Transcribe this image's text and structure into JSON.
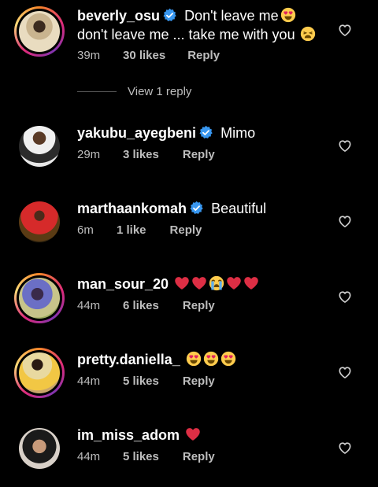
{
  "comments": [
    {
      "username": "beverly_osu",
      "verified": true,
      "text": "Don't leave me",
      "text_line2": "don't leave me ... take me with you",
      "time": "39m",
      "likes": "30 likes",
      "reply": "Reply",
      "story_ring": true
    },
    {
      "username": "yakubu_ayegbeni",
      "verified": true,
      "text": "Mimo",
      "time": "29m",
      "likes": "3 likes",
      "reply": "Reply",
      "story_ring": false
    },
    {
      "username": "marthaankomah",
      "verified": true,
      "text": "Beautiful",
      "time": "6m",
      "likes": "1 like",
      "reply": "Reply",
      "story_ring": false
    },
    {
      "username": "man_sour_20",
      "verified": false,
      "text": "",
      "time": "44m",
      "likes": "6 likes",
      "reply": "Reply",
      "story_ring": true
    },
    {
      "username": "pretty.daniella_",
      "verified": false,
      "text": "",
      "time": "44m",
      "likes": "5 likes",
      "reply": "Reply",
      "story_ring": true
    },
    {
      "username": "im_miss_adom",
      "verified": false,
      "text": "",
      "time": "44m",
      "likes": "5 likes",
      "reply": "Reply",
      "story_ring": false
    }
  ],
  "view_replies": "View 1 reply",
  "icons": {
    "like": "heart-outline-icon",
    "verified": "verified-badge-icon",
    "heart_eyes": "heart-eyes-emoji",
    "weary": "weary-face-emoji",
    "red_heart": "red-heart-emoji",
    "crying": "loudly-crying-emoji"
  },
  "colors": {
    "background": "#000000",
    "text": "#ffffff",
    "meta": "#bdbdbd",
    "verified": "#3897f0",
    "heart": "#e0245e"
  }
}
